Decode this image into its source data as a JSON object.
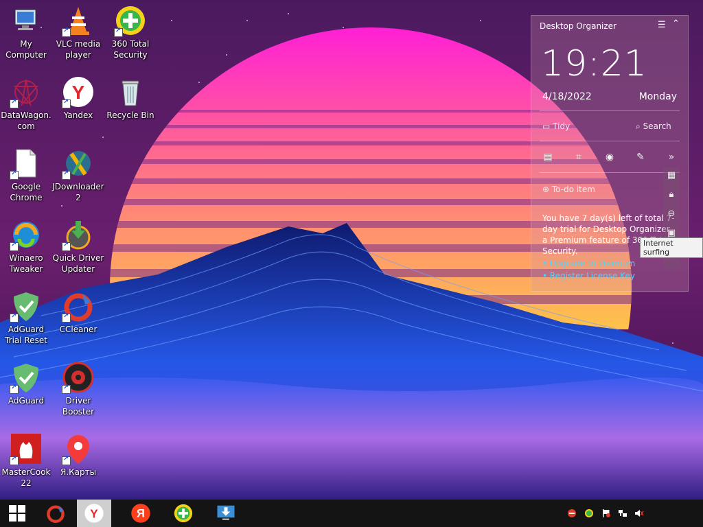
{
  "desktop": {
    "icons": [
      {
        "id": "my-computer",
        "label": "My Computer"
      },
      {
        "id": "vlc",
        "label": "VLC media player"
      },
      {
        "id": "security360",
        "label": "360 Total Security"
      },
      {
        "id": "datawagon",
        "label": "DataWagon.com"
      },
      {
        "id": "yandex",
        "label": "Yandex"
      },
      {
        "id": "recycle",
        "label": "Recycle Bin"
      },
      {
        "id": "chrome",
        "label": "Google Chrome"
      },
      {
        "id": "jdownloader",
        "label": "JDownloader 2"
      },
      {
        "id": "winaero",
        "label": "Winaero Tweaker"
      },
      {
        "id": "quickdriver",
        "label": "Quick Driver Updater"
      },
      {
        "id": "adguard-reset",
        "label": "AdGuard Trial Reset"
      },
      {
        "id": "ccleaner",
        "label": "CCleaner"
      },
      {
        "id": "adguard",
        "label": "AdGuard"
      },
      {
        "id": "driverbooster",
        "label": "Driver Booster"
      },
      {
        "id": "mastercook",
        "label": "MasterCook 22"
      },
      {
        "id": "yamaps",
        "label": "Я.Карты"
      }
    ]
  },
  "organizer": {
    "title": "Desktop Organizer",
    "time": "19:21",
    "date": "4/18/2022",
    "day": "Monday",
    "tidy_label": "Tidy",
    "search_label": "Search",
    "todo_label": "To-do item",
    "trial_text": "You have 7 day(s) left of total 7-day trial for Desktop Organizer, a Premium feature of 360 Total Security.",
    "upgrade_link": "• Upgrade to Premium",
    "register_link": "• Register License Key",
    "tooltip": "Internet surfing"
  },
  "colors": {
    "sun_top": "#ff2bd6",
    "sun_bottom": "#ffb347",
    "mountain": "#1a3ad6",
    "link": "#4fd3ff"
  }
}
